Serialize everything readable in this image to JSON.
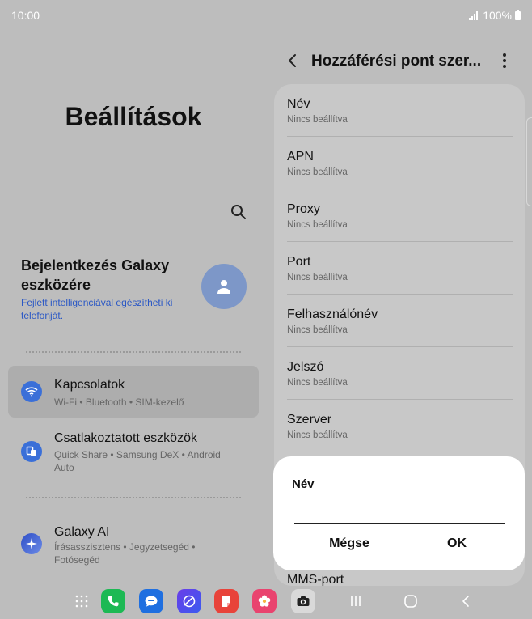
{
  "status_bar": {
    "time": "10:00",
    "battery": "100%"
  },
  "left_panel": {
    "title": "Beállítások",
    "account": {
      "title": "Bejelentkezés Galaxy eszközére",
      "subtitle": "Fejlett intelligenciával egészítheti ki telefonját."
    },
    "menu_items": [
      {
        "title": "Kapcsolatok",
        "subtitle": "Wi-Fi • Bluetooth • SIM-kezelő",
        "icon": "wifi-icon",
        "color": "#3a6fd8"
      },
      {
        "title": "Csatlakoztatott eszközök",
        "subtitle": "Quick Share • Samsung DeX • Android Auto",
        "icon": "devices-icon",
        "color": "#3a6fd8"
      },
      {
        "title": "Galaxy AI",
        "subtitle": "Írásasszisztens • Jegyzetsegéd • Fotósegéd",
        "icon": "sparkle-icon",
        "color": "#3b5bc9"
      }
    ]
  },
  "right_panel": {
    "title": "Hozzáférési pont szer...",
    "fields": [
      {
        "label": "Név",
        "value": "Nincs beállítva"
      },
      {
        "label": "APN",
        "value": "Nincs beállítva"
      },
      {
        "label": "Proxy",
        "value": "Nincs beállítva"
      },
      {
        "label": "Port",
        "value": "Nincs beállítva"
      },
      {
        "label": "Felhasználónév",
        "value": "Nincs beállítva"
      },
      {
        "label": "Jelszó",
        "value": "Nincs beállítva"
      },
      {
        "label": "Szerver",
        "value": "Nincs beállítva"
      }
    ],
    "partial_item": "MMS-port"
  },
  "dialog": {
    "title": "Név",
    "input_value": "",
    "cancel_label": "Mégse",
    "ok_label": "OK"
  },
  "taskbar": {
    "apps": [
      "apps-grid-icon",
      "phone-icon",
      "messages-icon",
      "internet-icon",
      "notes-icon",
      "gallery-icon",
      "camera-icon"
    ],
    "nav": [
      "recents-icon",
      "home-icon",
      "back-icon"
    ]
  },
  "colors": {
    "accent_blue": "#2b58c5",
    "dim_background": "#bdbdbd",
    "dialog_background": "#ffffff"
  }
}
